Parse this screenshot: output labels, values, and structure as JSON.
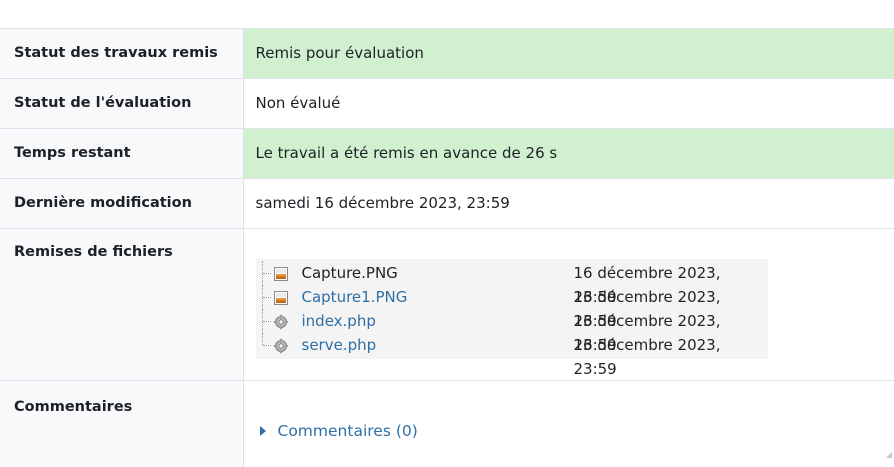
{
  "rows": {
    "submission_status": {
      "label": "Statut des travaux remis",
      "value": "Remis pour évaluation"
    },
    "grading_status": {
      "label": "Statut de l'évaluation",
      "value": "Non évalué"
    },
    "time_remaining": {
      "label": "Temps restant",
      "value": "Le travail a été remis en avance de 26 s"
    },
    "last_modified": {
      "label": "Dernière modification",
      "value": "samedi 16 décembre 2023, 23:59"
    },
    "file_submissions": {
      "label": "Remises de fichiers"
    },
    "comments": {
      "label": "Commentaires",
      "link": "Commentaires (0)"
    }
  },
  "files": [
    {
      "name": "Capture.PNG",
      "date": "16 décembre 2023, 23:59",
      "icon": "image-file-icon"
    },
    {
      "name": "Capture1.PNG",
      "date": "16 décembre 2023, 23:59",
      "icon": "image-file-icon"
    },
    {
      "name": "index.php",
      "date": "16 décembre 2023, 23:59",
      "icon": "code-file-icon"
    },
    {
      "name": "serve.php",
      "date": "16 décembre 2023, 23:59",
      "icon": "code-file-icon"
    }
  ],
  "colors": {
    "submitted_bg": "#d0f0d0",
    "link": "#2f6fa7",
    "header_bg": "#f8f9fa"
  }
}
